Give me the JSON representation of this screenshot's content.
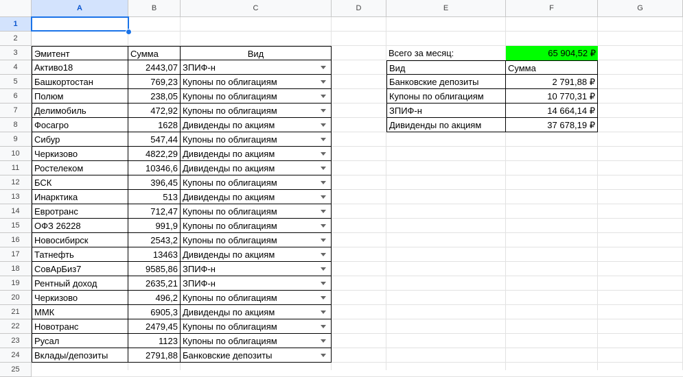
{
  "columns": [
    "A",
    "B",
    "C",
    "D",
    "E",
    "F",
    "G"
  ],
  "rows": [
    "1",
    "2",
    "3",
    "4",
    "5",
    "6",
    "7",
    "8",
    "9",
    "10",
    "11",
    "12",
    "13",
    "14",
    "15",
    "16",
    "17",
    "18",
    "19",
    "20",
    "21",
    "22",
    "23",
    "24",
    "25"
  ],
  "table": {
    "headers": {
      "issuer": "Эмитент",
      "amount": "Сумма",
      "type": "Вид"
    },
    "rows": [
      {
        "issuer": "Активо18",
        "amount": "2443,07",
        "type": "ЗПИФ-н"
      },
      {
        "issuer": "Башкортостан",
        "amount": "769,23",
        "type": "Купоны по облигациям"
      },
      {
        "issuer": "Полюм",
        "amount": "238,05",
        "type": "Купоны по облигациям"
      },
      {
        "issuer": "Делимобиль",
        "amount": "472,92",
        "type": "Купоны по облигациям"
      },
      {
        "issuer": "Фосагро",
        "amount": "1628",
        "type": "Дивиденды по акциям"
      },
      {
        "issuer": "Сибур",
        "amount": "547,44",
        "type": "Купоны по облигациям"
      },
      {
        "issuer": "Черкизово",
        "amount": "4822,29",
        "type": "Дивиденды по акциям"
      },
      {
        "issuer": "Ростелеком",
        "amount": "10346,6",
        "type": "Дивиденды по акциям"
      },
      {
        "issuer": "БСК",
        "amount": "396,45",
        "type": "Купоны по облигациям"
      },
      {
        "issuer": "Инарктика",
        "amount": "513",
        "type": "Дивиденды по акциям"
      },
      {
        "issuer": "Евротранс",
        "amount": "712,47",
        "type": "Купоны по облигациям"
      },
      {
        "issuer": "ОФЗ 26228",
        "amount": "991,9",
        "type": "Купоны по облигациям"
      },
      {
        "issuer": "Новосибирск",
        "amount": "2543,2",
        "type": "Купоны по облигациям"
      },
      {
        "issuer": "Татнефть",
        "amount": "13463",
        "type": "Дивиденды по акциям"
      },
      {
        "issuer": "СовАрБиз7",
        "amount": "9585,86",
        "type": "ЗПИФ-н"
      },
      {
        "issuer": "Рентный доход",
        "amount": "2635,21",
        "type": "ЗПИФ-н"
      },
      {
        "issuer": "Черкизово",
        "amount": "496,2",
        "type": "Купоны по облигациям"
      },
      {
        "issuer": "ММК",
        "amount": "6905,3",
        "type": "Дивиденды по акциям"
      },
      {
        "issuer": "Новотранс",
        "amount": "2479,45",
        "type": "Купоны по облигациям"
      },
      {
        "issuer": "Русал",
        "amount": "1123",
        "type": "Купоны по облигациям"
      },
      {
        "issuer": "Вклады/депозиты",
        "amount": "2791,88",
        "type": "Банковские депозиты"
      }
    ]
  },
  "summary": {
    "total_label": "Всего за месяц:",
    "total_value": "65 904,52 ₽",
    "total_color": "#00ff00",
    "headers": {
      "type": "Вид",
      "amount": "Сумма"
    },
    "rows": [
      {
        "type": "Банковские депозиты",
        "amount": "2 791,88 ₽"
      },
      {
        "type": "Купоны по облигациям",
        "amount": "10 770,31 ₽"
      },
      {
        "type": "ЗПИФ-н",
        "amount": "14 664,14 ₽"
      },
      {
        "type": "Дивиденды по акциям",
        "amount": "37 678,19 ₽"
      }
    ]
  },
  "selection": {
    "cell": "A1",
    "color": "#1a73e8"
  }
}
